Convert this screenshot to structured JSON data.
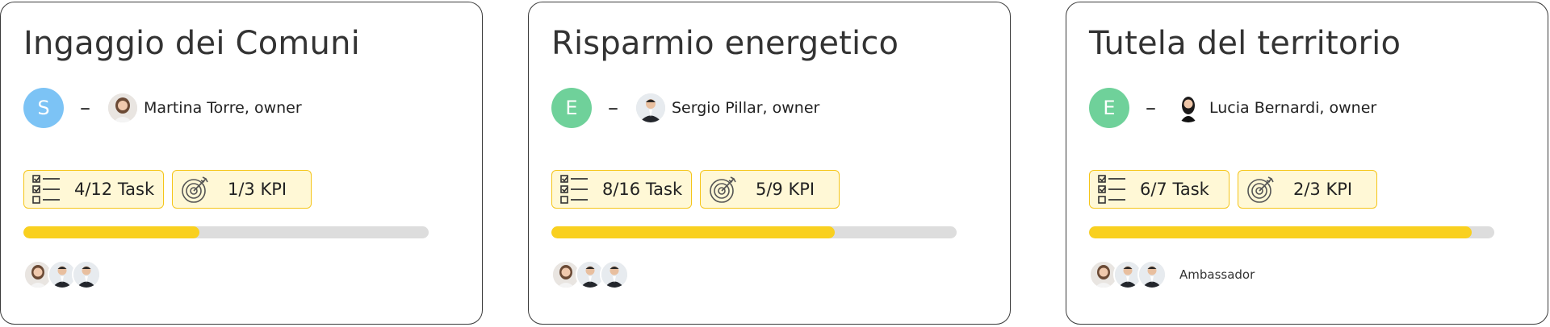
{
  "cards": [
    {
      "title": "Ingaggio dei Comuni",
      "initial": "S",
      "initial_color": "#7cc3f5",
      "owner_name": "Martina Torre, owner",
      "owner_avatar": "woman-avatar",
      "tasks_label": "4/12 Task",
      "kpi_label": "1/3 KPI",
      "progress_fraction": 0.435,
      "members": [
        "woman-avatar",
        "man-suit-avatar",
        "man-suit-avatar"
      ],
      "member_role": ""
    },
    {
      "title": "Risparmio energetico",
      "initial": "E",
      "initial_color": "#6fd19a",
      "owner_name": "Sergio Pillar, owner",
      "owner_avatar": "man-suit-avatar",
      "tasks_label": "8/16 Task",
      "kpi_label": "5/9 KPI",
      "progress_fraction": 0.7,
      "members": [
        "woman-avatar",
        "man-suit-avatar",
        "man-suit-avatar"
      ],
      "member_role": ""
    },
    {
      "title": "Tutela del territorio",
      "initial": "E",
      "initial_color": "#6fd19a",
      "owner_name": "Lucia Bernardi, owner",
      "owner_avatar": "woman-dark-hair-avatar",
      "tasks_label": "6/7 Task",
      "kpi_label": "2/3 KPI",
      "progress_fraction": 0.945,
      "members": [
        "woman-avatar",
        "man-suit-avatar",
        "man-suit-avatar"
      ],
      "member_role": "Ambassador"
    }
  ],
  "colors": {
    "accent_yellow": "#f9d01f",
    "badge_border": "#f5c518",
    "badge_bg": "#fff8d6",
    "track": "#dddddd"
  },
  "icons": {
    "tasks": "checklist-icon",
    "kpi": "target-icon"
  }
}
